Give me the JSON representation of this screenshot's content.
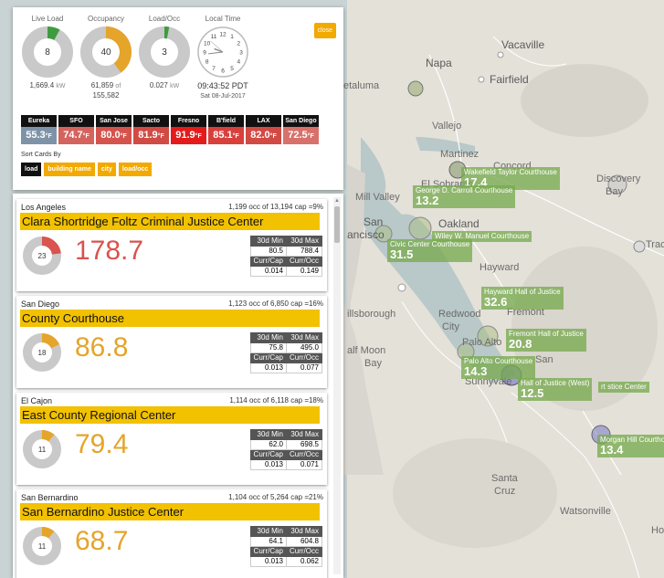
{
  "map": {
    "places": [
      "Vacaville",
      "Napa",
      "Fairfield",
      "etaluma",
      "Vallejo",
      "Martinez",
      "Concord",
      "Discovery",
      "Bay",
      "Mill Valley",
      "El Sobrante",
      "San",
      "ancisco",
      "Oakland",
      "Hayward",
      "Tracy",
      "illsborough",
      "Redwood",
      "City",
      "alf Moon",
      "Bay",
      "Palo Alto",
      "Fremont",
      "Sunnyvale",
      "San",
      "Santa",
      "Cruz",
      "Watsonville",
      "Ho"
    ],
    "markers": [
      {
        "name": "Wakefield Taylor Courthouse",
        "value": "17.4"
      },
      {
        "name": "George D. Carroll Courthouse",
        "value": "13.2"
      },
      {
        "name": "Wiley W. Manuel Courthouse",
        "value": ""
      },
      {
        "name": "Civic Center Courthouse",
        "value": "31.5"
      },
      {
        "name": "Hayward Hall of Justice",
        "value": "32.6"
      },
      {
        "name": "Fremont Hall of Justice",
        "value": "20.8"
      },
      {
        "name": "Palo Alto Courthouse",
        "value": "14.3"
      },
      {
        "name": "Hall of Justice (West)",
        "value": "12.5"
      },
      {
        "name": "rt  stice Center",
        "value": ""
      },
      {
        "name": "Morgan Hill Courthouse",
        "value": "13.4"
      }
    ]
  },
  "summary": {
    "close_label": "close",
    "gauges": [
      {
        "title": "Live Load",
        "center": "8",
        "sub_value": "1,669.4",
        "sub_unit": "kW",
        "fraction": 0.08,
        "color": "#3f9b3f"
      },
      {
        "title": "Occupancy",
        "center": "40",
        "sub_value": "61,859",
        "sub_unit": "of",
        "sub_line2": "155,582",
        "fraction": 0.4,
        "color": "#e5a42a"
      },
      {
        "title": "Load/Occ",
        "center": "3",
        "sub_value": "0.027",
        "sub_unit": "kW",
        "fraction": 0.03,
        "color": "#3f9b3f"
      }
    ],
    "clock": {
      "title": "Local Time",
      "time": "09:43:52 PDT",
      "date": "Sat 08-Jul-2017",
      "numerals": [
        "12",
        "1",
        "2",
        "3",
        "4",
        "5",
        "6",
        "7",
        "8",
        "9",
        "10",
        "11"
      ]
    },
    "temps": [
      {
        "city": "Eureka",
        "value": "55.3",
        "unit": "°F",
        "color": "#7f93a8"
      },
      {
        "city": "SFO",
        "value": "74.7",
        "unit": "°F",
        "color": "#d4635e"
      },
      {
        "city": "San Jose",
        "value": "80.0",
        "unit": "°F",
        "color": "#d4544d"
      },
      {
        "city": "Sacto",
        "value": "81.9",
        "unit": "°F",
        "color": "#d24a44"
      },
      {
        "city": "Fresno",
        "value": "91.9",
        "unit": "°F",
        "color": "#e51b1b"
      },
      {
        "city": "B'field",
        "value": "85.1",
        "unit": "°F",
        "color": "#d8403b"
      },
      {
        "city": "LAX",
        "value": "82.0",
        "unit": "°F",
        "color": "#d24a44"
      },
      {
        "city": "San Diego",
        "value": "72.5",
        "unit": "°F",
        "color": "#d8716a"
      }
    ],
    "sort_label": "Sort Cards By",
    "sort_buttons": [
      "load",
      "building name",
      "city",
      "load/occ"
    ]
  },
  "cards": [
    {
      "city": "Los Angeles",
      "occ": "1,199 occ of 13,194 cap =9%",
      "name": "Clara Shortridge Foltz Criminal Justice Center",
      "donut": "23",
      "fraction": 0.23,
      "donut_color": "#d9534f",
      "load": "178.7",
      "load_color": "#d9534f",
      "min30_label": "30d Min",
      "max30_label": "30d Max",
      "min30": "80.5",
      "max30": "788.4",
      "currcap_label": "Curr/Cap",
      "currocc_label": "Curr/Occ",
      "currcap": "0.014",
      "currocc": "0.149"
    },
    {
      "city": "San Diego",
      "occ": "1,123 occ of 6,850 cap =16%",
      "name": "County Courthouse",
      "donut": "18",
      "fraction": 0.18,
      "donut_color": "#e5a42a",
      "load": "86.8",
      "load_color": "#e5a42a",
      "min30_label": "30d Min",
      "max30_label": "30d Max",
      "min30": "75.8",
      "max30": "495.0",
      "currcap_label": "Curr/Cap",
      "currocc_label": "Curr/Occ",
      "currcap": "0.013",
      "currocc": "0.077"
    },
    {
      "city": "El Cajon",
      "occ": "1,114 occ of 6,118 cap =18%",
      "name": "East County Regional Center",
      "donut": "11",
      "fraction": 0.11,
      "donut_color": "#e5a42a",
      "load": "79.4",
      "load_color": "#e5a42a",
      "min30_label": "30d Min",
      "max30_label": "30d Max",
      "min30": "62.0",
      "max30": "698.5",
      "currcap_label": "Curr/Cap",
      "currocc_label": "Curr/Occ",
      "currcap": "0.013",
      "currocc": "0.071"
    },
    {
      "city": "San Bernardino",
      "occ": "1,104 occ of 5,264 cap =21%",
      "name": "San Bernardino Justice Center",
      "donut": "11",
      "fraction": 0.11,
      "donut_color": "#e5a42a",
      "load": "68.7",
      "load_color": "#e5a42a",
      "min30_label": "30d Min",
      "max30_label": "30d Max",
      "min30": "64.1",
      "max30": "604.8",
      "currcap_label": "Curr/Cap",
      "currocc_label": "Curr/Occ",
      "currcap": "0.013",
      "currocc": "0.062"
    }
  ]
}
